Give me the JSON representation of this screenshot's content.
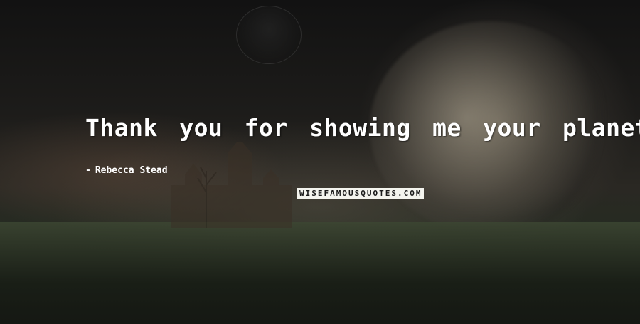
{
  "quote": {
    "text": "Thank you for showing me your planet.",
    "author_dash": "-",
    "author": "Rebecca Stead"
  },
  "watermark": {
    "text": "WISEFAMOUSQUOTES.COM"
  },
  "colors": {
    "text": "#ffffff",
    "background": "#141414",
    "watermark_bg": "#f4f4ee"
  }
}
